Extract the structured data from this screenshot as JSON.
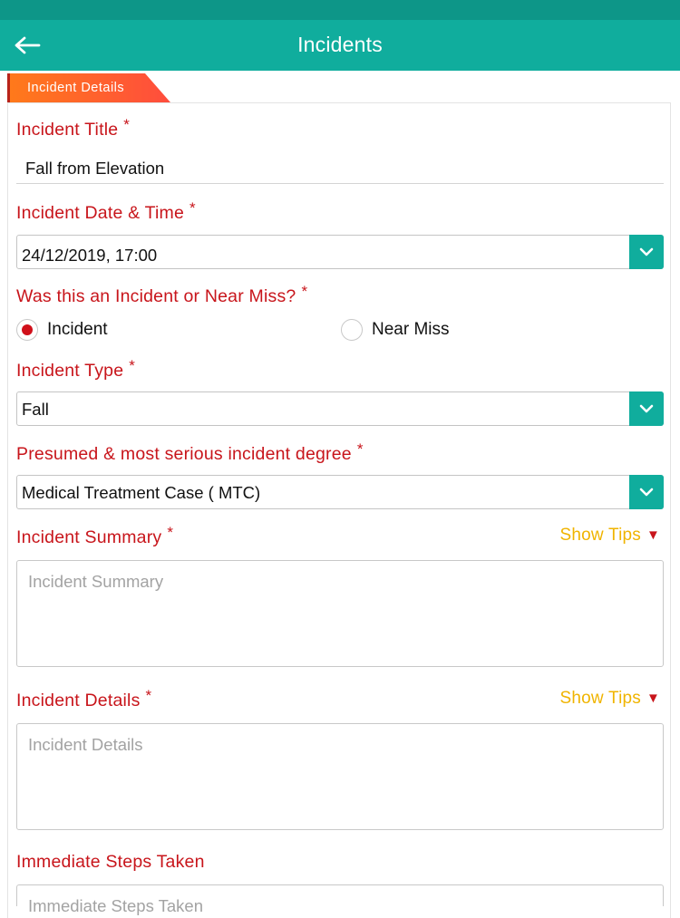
{
  "header": {
    "title": "Incidents",
    "back_icon": "arrow-left-icon"
  },
  "tab": {
    "label": "Incident Details"
  },
  "form": {
    "required_marker": "*",
    "incident_title": {
      "label": "Incident Title",
      "value": "Fall from Elevation"
    },
    "incident_datetime": {
      "label": "Incident Date & Time",
      "value": "24/12/2019, 17:00"
    },
    "incident_or_near_miss": {
      "label": "Was this an Incident or Near Miss?",
      "options": [
        "Incident",
        "Near Miss"
      ],
      "selected": "Incident"
    },
    "incident_type": {
      "label": "Incident Type",
      "value": "Fall"
    },
    "incident_degree": {
      "label": "Presumed & most serious incident degree",
      "value": "Medical Treatment Case ( MTC)"
    },
    "incident_summary": {
      "label": "Incident Summary",
      "placeholder": "Incident Summary",
      "tips": "Show Tips"
    },
    "incident_details": {
      "label": "Incident Details",
      "placeholder": "Incident Details",
      "tips": "Show Tips"
    },
    "immediate_steps": {
      "label": "Immediate Steps Taken",
      "placeholder": "Immediate Steps Taken"
    }
  },
  "colors": {
    "primary": "#10ad9d",
    "status_bar": "#0d9688",
    "label_red": "#c8151b",
    "tips_yellow": "#f0b400",
    "tab_orange": "#ff6a2e"
  }
}
